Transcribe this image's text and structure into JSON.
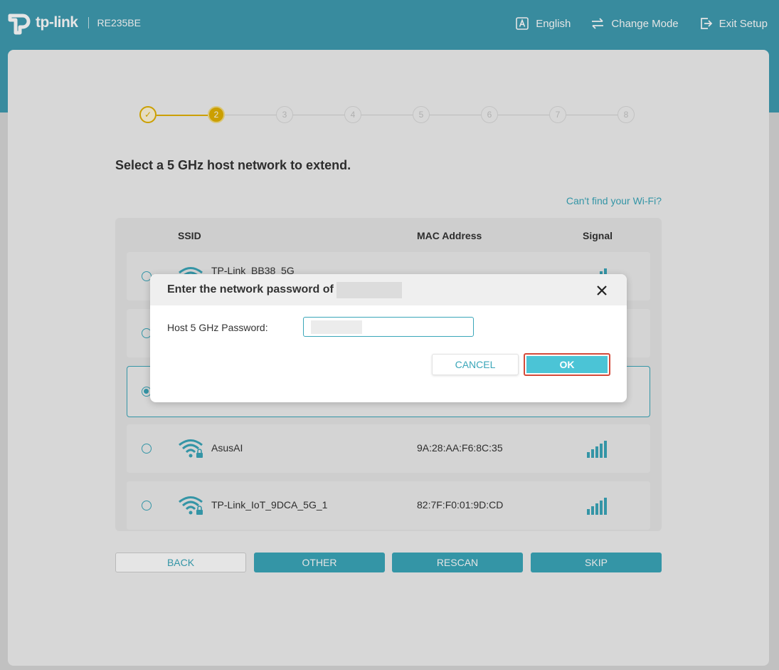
{
  "header": {
    "brand": "tp-link",
    "model": "RE235BE",
    "nav": [
      {
        "label": "English",
        "icon": "language-icon"
      },
      {
        "label": "Change Mode",
        "icon": "switch-arrows-icon"
      },
      {
        "label": "Exit Setup",
        "icon": "exit-icon"
      }
    ]
  },
  "stepper": {
    "steps": [
      "✓",
      "2",
      "3",
      "4",
      "5",
      "6",
      "7",
      "8"
    ],
    "current": 2,
    "completed": 1
  },
  "page": {
    "heading": "Select a 5 GHz host network to extend.",
    "cant_find_link": "Can't find your Wi-Fi?"
  },
  "table": {
    "columns": [
      "SSID",
      "MAC Address",
      "Signal"
    ],
    "rows": [
      {
        "ssid": "TP-Link_BB38_5G",
        "mac": "",
        "signal_bars": 5,
        "selected": false
      },
      {
        "ssid": "",
        "mac": "",
        "signal_bars": 0,
        "selected": false
      },
      {
        "ssid": "",
        "mac": "",
        "signal_bars": 0,
        "selected": true
      },
      {
        "ssid": "AsusAI",
        "mac": "9A:28:AA:F6:8C:35",
        "signal_bars": 5,
        "selected": false
      },
      {
        "ssid": "TP-Link_IoT_9DCA_5G_1",
        "mac": "82:7F:F0:01:9D:CD",
        "signal_bars": 5,
        "selected": false
      }
    ]
  },
  "buttons": {
    "back": "BACK",
    "other": "OTHER",
    "rescan": "RESCAN",
    "skip": "SKIP"
  },
  "modal": {
    "title": "Enter the network password of",
    "password_label": "Host 5 GHz Password:",
    "password_value": "",
    "cancel": "CANCEL",
    "ok": "OK"
  },
  "colors": {
    "brand": "#3f9bb0",
    "accent": "#3aa6b9",
    "step": "#e2b100",
    "highlight": "#d44a3a"
  }
}
